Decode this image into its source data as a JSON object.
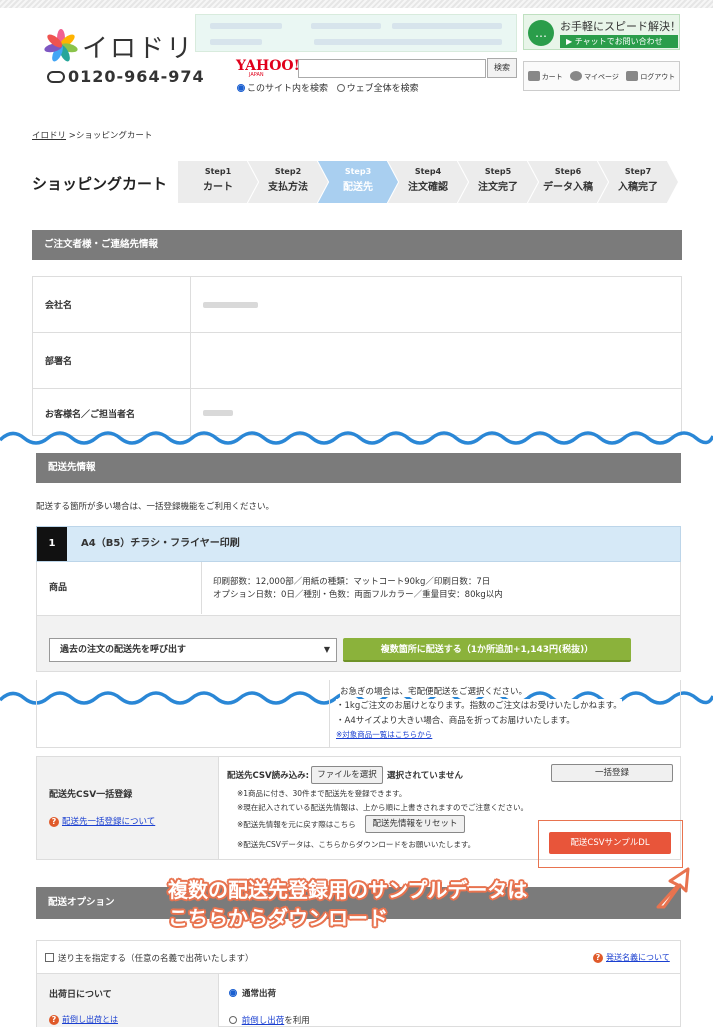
{
  "header": {
    "logo_text": "イロドリ",
    "tel": "0120-964-974",
    "chat_title": "お手軽にスピード解決！",
    "chat_link": "▶ チャットでお問い合わせ",
    "search": {
      "yahoo": "YAHOO!",
      "yahoo_sub": "JAPAN",
      "button": "検索",
      "value": "",
      "option_site": "このサイト内を検索",
      "option_web": "ウェブ全体を検索"
    },
    "util": {
      "cart": "カート",
      "mypage": "マイページ",
      "logout": "ログアウト"
    }
  },
  "breadcrumb": {
    "home": "イロドリ",
    "sep": " >",
    "current": "ショッピングカート"
  },
  "page_title": "ショッピングカート",
  "steps": [
    {
      "num": "Step1",
      "label": "カート"
    },
    {
      "num": "Step2",
      "label": "支払方法"
    },
    {
      "num": "Step3",
      "label": "配送先"
    },
    {
      "num": "Step4",
      "label": "注文確認"
    },
    {
      "num": "Step5",
      "label": "注文完了"
    },
    {
      "num": "Step6",
      "label": "データ入稿"
    },
    {
      "num": "Step7",
      "label": "入稿完了"
    }
  ],
  "active_step": 3,
  "orderer": {
    "title": "ご注文者様・ご連絡先情報",
    "company_label": "会社名",
    "department_label": "部署名",
    "name_label": "お客様名／ご担当者名"
  },
  "delivery": {
    "title": "配送先情報",
    "note": "配送する箇所が多い場合は、一括登録機能をご利用ください。",
    "product_num": "1",
    "product_name": "A4（B5）チラシ・フライヤー印刷",
    "product_label": "商品",
    "product_line1": "印刷部数：12,000部／用紙の種類：マットコート90kg／印刷日数：7日",
    "product_line2": "オプション日数：0日／種別・色数：両面フルカラー／重量目安：80kg以内",
    "select_value": "過去の注文の配送先を呼び出す",
    "multi_button": "複数箇所に配送する（1か所追加+1,143円(税抜)）",
    "info_1": "お急ぎの場合は、宅配便配送をご選択ください。",
    "info_2": "・1kgご注文のお届けとなります。指数のご注文はお受けいたしかねます。",
    "info_3": "・A4サイズより大きい場合、商品を折ってお届けいたします。",
    "info_link": "※対象商品一覧はこちらから"
  },
  "csv": {
    "title": "配送先CSV一括登録",
    "help": "配送先一括登録について",
    "read_label": "配送先CSV読み込み:",
    "file_button": "ファイルを選択",
    "file_status": "選択されていません",
    "bulk_button": "一括登録",
    "note1": "※1商品に付き、30件まで配送先を登録できます。",
    "note2": "※現在記入されている配送先情報は、上から順に上書きされますのでご注意ください。",
    "note3": "※配送先情報を元に戻す際はこちら",
    "reset_button": "配送先情報をリセット",
    "note4": "※配送先CSVデータは、こちらからダウンロードをお願いいたします。",
    "download_button": "配送CSVサンプルDL"
  },
  "callout": {
    "line1": "複数の配送先登録用のサンプルデータは",
    "line2": "こちらからダウンロード"
  },
  "options": {
    "title": "配送オプション",
    "sender_label": "送り主を指定する（任意の名義で出荷いたします）",
    "sender_help": "発送名義について",
    "ship_label": "出荷日について",
    "ship_help": "前倒し出荷とは",
    "normal": "通常出荷",
    "early": "前倒し出荷",
    "early_suffix": "を利用"
  },
  "colors": {
    "active_step": "#a9cff0",
    "section": "#7b7b7b",
    "multi_button": "#8bb23b",
    "download": "#e8553a",
    "callout": "#e8734f"
  }
}
